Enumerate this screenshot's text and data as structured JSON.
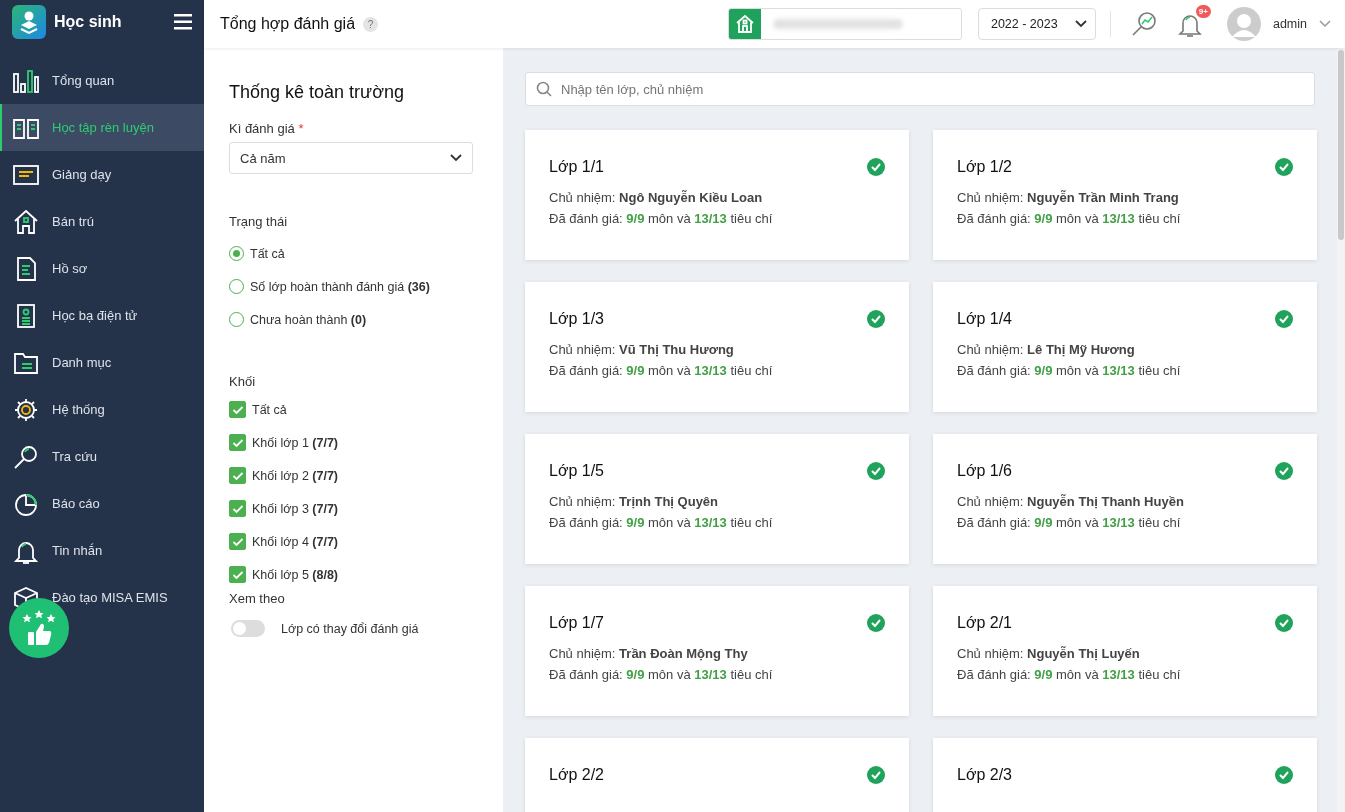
{
  "app": {
    "name": "Học sinh"
  },
  "sidebar": {
    "items": [
      {
        "label": "Tổng quan",
        "selected": false
      },
      {
        "label": "Học tập rèn luyện",
        "selected": true
      },
      {
        "label": "Giảng dạy",
        "selected": false
      },
      {
        "label": "Bán trú",
        "selected": false
      },
      {
        "label": "Hồ sơ",
        "selected": false
      },
      {
        "label": "Học bạ điện tử",
        "selected": false
      },
      {
        "label": "Danh mục",
        "selected": false
      },
      {
        "label": "Hệ thống",
        "selected": false
      },
      {
        "label": "Tra cứu",
        "selected": false
      },
      {
        "label": "Báo cáo",
        "selected": false
      },
      {
        "label": "Tin nhắn",
        "selected": false
      },
      {
        "label": "Đào tạo MISA EMIS",
        "selected": false
      }
    ]
  },
  "header": {
    "title": "Tổng hợp đánh giá",
    "help": "?",
    "school_year": "2022 - 2023",
    "notification_badge": "9+",
    "user": "admin"
  },
  "filters": {
    "title": "Thống kê toàn trường",
    "period": {
      "label": "Kì đánh giá",
      "required": "*",
      "value": "Cả năm"
    },
    "status": {
      "label": "Trạng thái",
      "options": [
        {
          "label": "Tất cả",
          "selected": true
        },
        {
          "label": "Số lớp hoàn thành đánh giá **(36)**",
          "selected": false
        },
        {
          "label": "Chưa hoàn thành **(0)**",
          "selected": false
        }
      ]
    },
    "grades": {
      "label": "Khối",
      "options": [
        {
          "label": "Tất cả",
          "checked": true
        },
        {
          "label": "Khối lớp 1 **(7/7)**",
          "checked": true
        },
        {
          "label": "Khối lớp 2 **(7/7)**",
          "checked": true
        },
        {
          "label": "Khối lớp 3 **(7/7)**",
          "checked": true
        },
        {
          "label": "Khối lớp 4 **(7/7)**",
          "checked": true
        },
        {
          "label": "Khối lớp 5 **(8/8)**",
          "checked": true
        }
      ]
    },
    "view": {
      "label": "Xem theo",
      "toggle_label": "Lớp có thay đổi đánh giá",
      "on": false
    }
  },
  "search": {
    "placeholder": "Nhập tên lớp, chủ nhiệm"
  },
  "classes": [
    {
      "name": "Lớp 1/1",
      "teacher": "Chủ nhiệm: **Ngô Nguyễn Kiều Loan**",
      "progress": "Đã đánh giá: **9/9** môn và **13/13** tiêu chí",
      "done": true
    },
    {
      "name": "Lớp 1/2",
      "teacher": "Chủ nhiệm: **Nguyễn Trần Minh Trang**",
      "progress": "Đã đánh giá: **9/9** môn và **13/13** tiêu chí",
      "done": true
    },
    {
      "name": "Lớp 1/3",
      "teacher": "Chủ nhiệm: **Vũ Thị Thu Hương**",
      "progress": "Đã đánh giá: **9/9** môn và **13/13** tiêu chí",
      "done": true
    },
    {
      "name": "Lớp 1/4",
      "teacher": "Chủ nhiệm: **Lê Thị Mỹ Hương**",
      "progress": "Đã đánh giá: **9/9** môn và **13/13** tiêu chí",
      "done": true
    },
    {
      "name": "Lớp 1/5",
      "teacher": "Chủ nhiệm: **Trịnh Thị Quyên**",
      "progress": "Đã đánh giá: **9/9** môn và **13/13** tiêu chí",
      "done": true
    },
    {
      "name": "Lớp 1/6",
      "teacher": "Chủ nhiệm: **Nguyễn Thị Thanh Huyền**",
      "progress": "Đã đánh giá: **9/9** môn và **13/13** tiêu chí",
      "done": true
    },
    {
      "name": "Lớp 1/7",
      "teacher": "Chủ nhiệm: **Trần Đoàn Mộng Thy**",
      "progress": "Đã đánh giá: **9/9** môn và **13/13** tiêu chí",
      "done": true
    },
    {
      "name": "Lớp 2/1",
      "teacher": "Chủ nhiệm: **Nguyễn Thị Luyến**",
      "progress": "Đã đánh giá: **9/9** môn và **13/13** tiêu chí",
      "done": true
    },
    {
      "name": "Lớp 2/2",
      "done": true
    },
    {
      "name": "Lớp 2/3",
      "done": true
    }
  ]
}
